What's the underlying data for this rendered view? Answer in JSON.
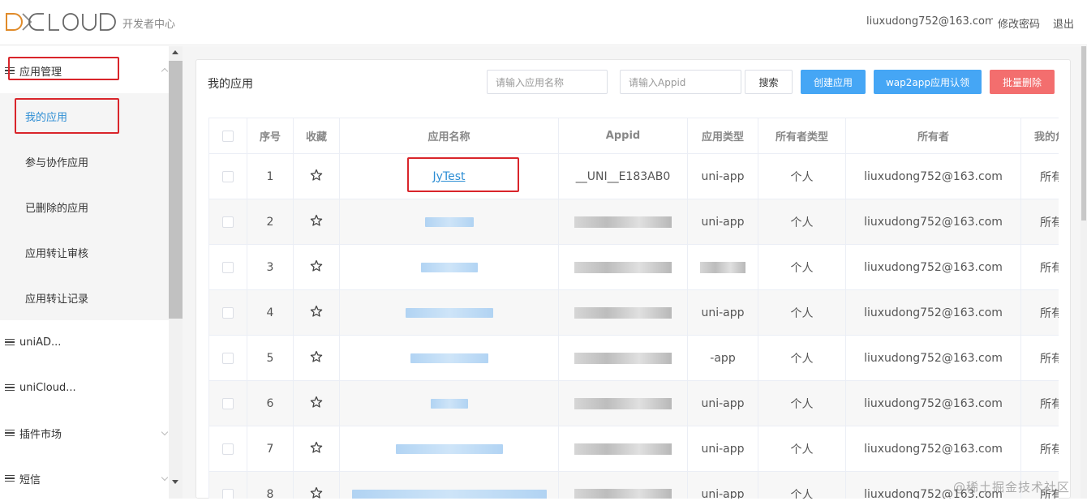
{
  "header": {
    "logo": "DCLOUD",
    "subtitle": "开发者中心",
    "user": "liuxudong752@163.com",
    "change_password": "修改密码",
    "logout": "退出"
  },
  "sidebar": {
    "groups": [
      {
        "label": "应用管理",
        "expanded": true
      },
      {
        "label": "uniAD..."
      },
      {
        "label": "uniCloud..."
      },
      {
        "label": "插件市场"
      },
      {
        "label": "短信"
      }
    ],
    "submenu": [
      {
        "label": "我的应用",
        "active": true
      },
      {
        "label": "参与协作应用"
      },
      {
        "label": "已删除的应用"
      },
      {
        "label": "应用转让审核"
      },
      {
        "label": "应用转让记录"
      }
    ]
  },
  "main": {
    "title": "我的应用",
    "search_name_placeholder": "请输入应用名称",
    "search_appid_placeholder": "请输入Appid",
    "search_button": "搜索",
    "create_button": "创建应用",
    "wap2app_button": "wap2app应用认领",
    "batch_delete_button": "批量删除"
  },
  "table": {
    "columns": [
      "序号",
      "收藏",
      "应用名称",
      "Appid",
      "应用类型",
      "所有者类型",
      "所有者",
      "我的角色"
    ],
    "rows": [
      {
        "index": "1",
        "name": "JyTest",
        "appid": "__UNI__E183AB0",
        "type": "uni-app",
        "owner_type": "个人",
        "owner": "liuxudong752@163.com",
        "role": "所有者"
      },
      {
        "index": "2",
        "name": "",
        "appid": "",
        "type": "uni-app",
        "owner_type": "个人",
        "owner": "liuxudong752@163.com",
        "role": "所有者"
      },
      {
        "index": "3",
        "name": "",
        "appid": "",
        "type": "",
        "owner_type": "个人",
        "owner": "liuxudong752@163.com",
        "role": "所有者"
      },
      {
        "index": "4",
        "name": "",
        "appid": "",
        "type": "uni-app",
        "owner_type": "个人",
        "owner": "liuxudong752@163.com",
        "role": "所有者"
      },
      {
        "index": "5",
        "name": "",
        "appid": "",
        "type": "-app",
        "owner_type": "个人",
        "owner": "liuxudong752@163.com",
        "role": "所有者"
      },
      {
        "index": "6",
        "name": "",
        "appid": "",
        "type": "uni-app",
        "owner_type": "个人",
        "owner": "liuxudong752@163.com",
        "role": "所有者"
      },
      {
        "index": "7",
        "name": "",
        "appid": "",
        "type": "uni-app",
        "owner_type": "个人",
        "owner": "liuxudong752@163.com",
        "role": "所有者"
      },
      {
        "index": "8",
        "name": "",
        "appid": "",
        "type": "uni-app",
        "owner_type": "个人",
        "owner": "liuxudong752@163.com",
        "role": "所有者"
      }
    ]
  },
  "watermark": "@稀土掘金技术社区",
  "colors": {
    "accent": "#45a6f5",
    "danger": "#f36e6e",
    "link": "#2c8dd4",
    "highlight_box": "#d9252b"
  }
}
